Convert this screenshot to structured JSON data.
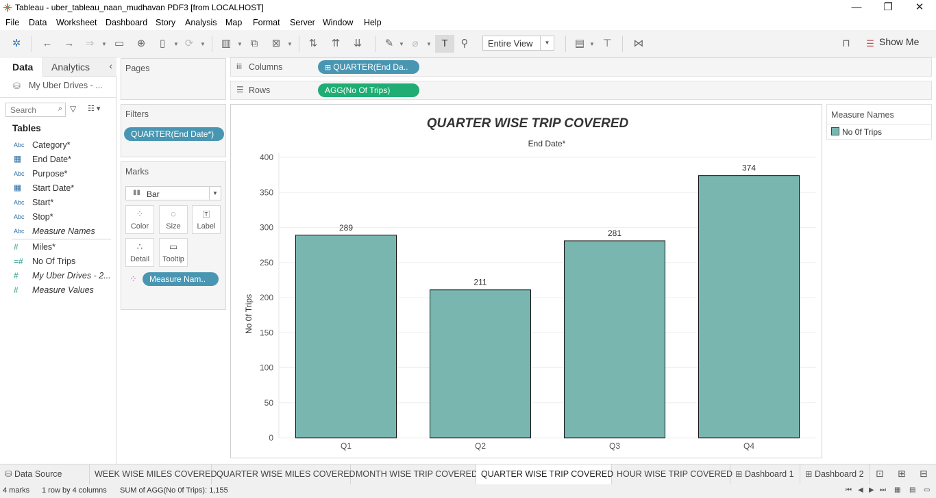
{
  "window": {
    "title": "Tableau - uber_tableau_naan_mudhavan PDF3 [from LOCALHOST]"
  },
  "menu": [
    "File",
    "Data",
    "Worksheet",
    "Dashboard",
    "Story",
    "Analysis",
    "Map",
    "Format",
    "Server",
    "Window",
    "Help"
  ],
  "toolbar": {
    "view_select": "Entire View",
    "show_me": "Show Me"
  },
  "left_pane": {
    "tabs": [
      "Data",
      "Analytics"
    ],
    "datasource": "My Uber Drives - ...",
    "search_placeholder": "Search",
    "tables_heading": "Tables",
    "fields": [
      {
        "icon": "Abc",
        "name": "Category*"
      },
      {
        "icon": "date",
        "name": "End Date*"
      },
      {
        "icon": "Abc",
        "name": "Purpose*"
      },
      {
        "icon": "date",
        "name": "Start Date*"
      },
      {
        "icon": "Abc",
        "name": "Start*"
      },
      {
        "icon": "Abc",
        "name": "Stop*"
      },
      {
        "icon": "Abc",
        "name": "Measure Names"
      },
      {
        "icon": "#",
        "name": "Miles*"
      },
      {
        "icon": "#",
        "name": "No Of Trips"
      },
      {
        "icon": "#",
        "name": "My Uber Drives - 2..."
      },
      {
        "icon": "#",
        "name": "Measure Values"
      }
    ]
  },
  "cards": {
    "pages": "Pages",
    "filters": "Filters",
    "filter_pill": "QUARTER(End Date*)",
    "marks": "Marks",
    "mark_type": "Bar",
    "mark_buttons": [
      "Color",
      "Size",
      "Label",
      "Detail",
      "Tooltip"
    ],
    "marks_pill": "Measure Nam.."
  },
  "shelves": {
    "columns_label": "Columns",
    "columns_pill": "QUARTER(End Da..",
    "rows_label": "Rows",
    "rows_pill": "AGG(No Of Trips)"
  },
  "legend": {
    "title": "Measure Names",
    "item": "No 0f Trips",
    "color": "#79b6b0"
  },
  "chart_data": {
    "type": "bar",
    "title": "QUARTER WISE TRIP COVERED",
    "header": "End Date*",
    "ylabel": "No 0f Trips",
    "categories": [
      "Q1",
      "Q2",
      "Q3",
      "Q4"
    ],
    "values": [
      289,
      211,
      281,
      374
    ],
    "ylim": [
      0,
      400
    ],
    "yticks": [
      0,
      50,
      100,
      150,
      200,
      250,
      300,
      350,
      400
    ],
    "bar_color": "#79b6b0",
    "grid": true
  },
  "sheet_tabs": [
    "Data Source",
    "WEEK WISE MILES COVERED",
    "QUARTER WISE MILES COVERED",
    "MONTH WISE TRIP COVERED",
    "QUARTER WISE TRIP COVERED",
    "HOUR WISE TRIP COVERED",
    "Dashboard 1",
    "Dashboard 2"
  ],
  "active_tab": "QUARTER WISE TRIP COVERED",
  "status": {
    "marks": "4 marks",
    "rows": "1 row by 4 columns",
    "sum": "SUM of AGG(No 0f Trips): 1,155"
  }
}
